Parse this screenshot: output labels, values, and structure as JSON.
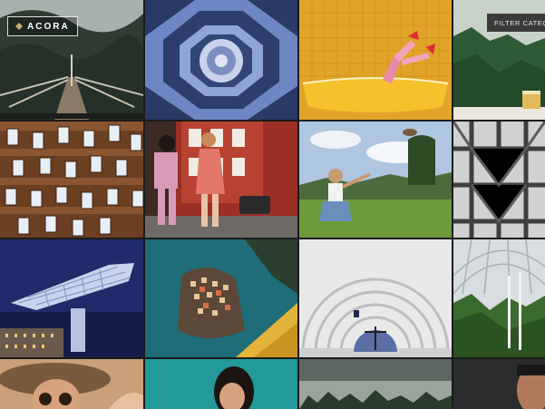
{
  "header": {
    "logo_text": "ACORA",
    "logo_icon": "diamond-mark-icon",
    "filter_label": "FILTER CATEGO"
  },
  "gallery": {
    "rows": 4,
    "columns": 4,
    "tiles": [
      {
        "subject": "bridge-landscape"
      },
      {
        "subject": "octagon-ceiling"
      },
      {
        "subject": "legs-in-bathtub"
      },
      {
        "subject": "forest-mist-mug"
      },
      {
        "subject": "building-facade"
      },
      {
        "subject": "two-women-street"
      },
      {
        "subject": "girl-in-field"
      },
      {
        "subject": "steel-structure"
      },
      {
        "subject": "futuristic-building"
      },
      {
        "subject": "coastal-village"
      },
      {
        "subject": "dome-acrobat"
      },
      {
        "subject": "greenhouse"
      },
      {
        "subject": "woman-in-hat"
      },
      {
        "subject": "woman-on-teal"
      },
      {
        "subject": "misty-forest"
      },
      {
        "subject": "man-portrait"
      }
    ]
  },
  "colors": {
    "accent": "#c9a96e",
    "filter_bg": "#3a3a3a"
  }
}
